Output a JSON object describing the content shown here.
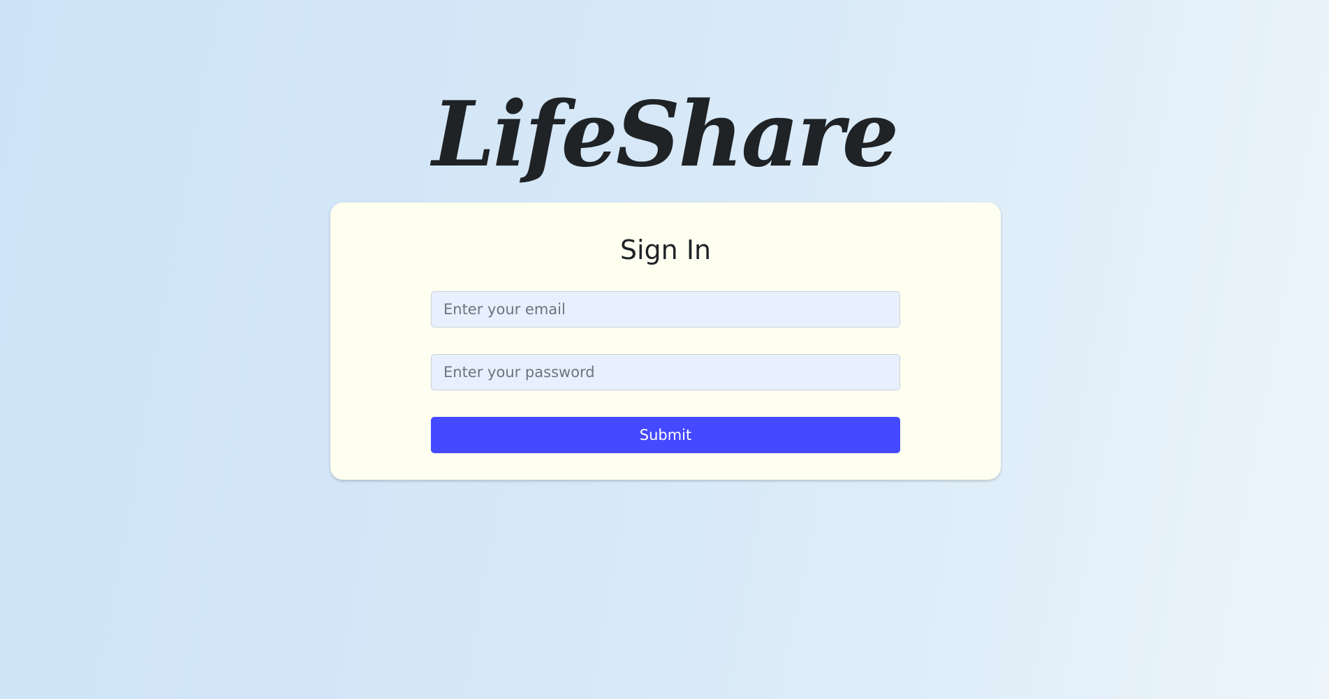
{
  "brand": {
    "logo_text": "LifeShare"
  },
  "signin": {
    "title": "Sign In",
    "email": {
      "value": "",
      "placeholder": "Enter your email"
    },
    "password": {
      "value": "",
      "placeholder": "Enter your password"
    },
    "submit_label": "Submit"
  },
  "colors": {
    "card_background": "#fefff0",
    "input_background": "#e8effd",
    "accent": "#4549ff",
    "text": "#1f2326"
  }
}
